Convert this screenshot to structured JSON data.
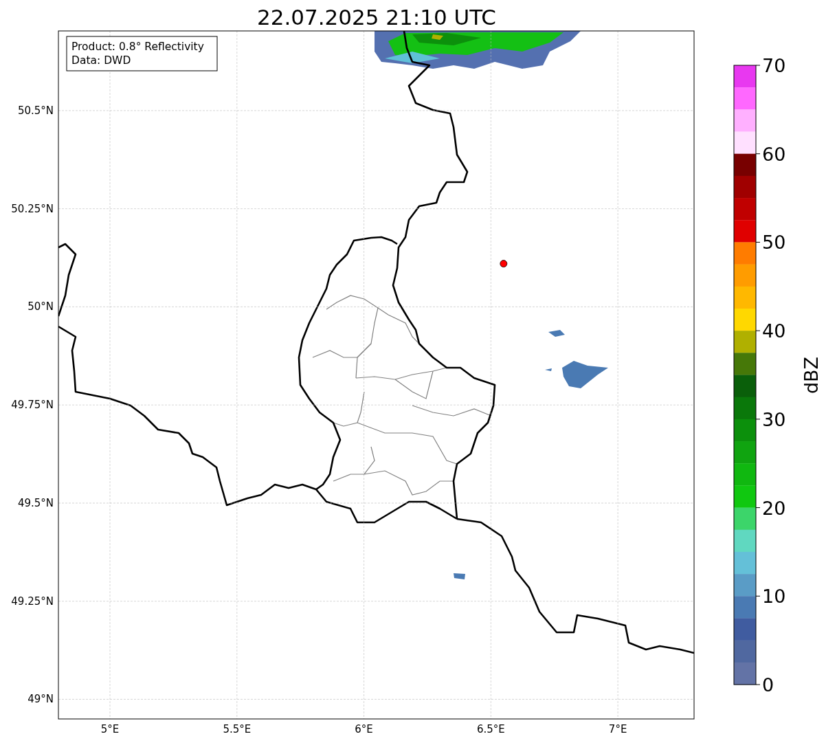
{
  "title": "22.07.2025 21:10 UTC",
  "info": [
    "Product: 0.8° Reflectivity",
    "Data: DWD"
  ],
  "chart_data": {
    "type": "scatter",
    "grid": true,
    "xlim": [
      4.797,
      7.3
    ],
    "ylim": [
      48.95,
      50.703
    ],
    "xticks": [
      {
        "value": 5,
        "label": "5°E"
      },
      {
        "value": 5.5,
        "label": "5.5°E"
      },
      {
        "value": 6,
        "label": "6°E"
      },
      {
        "value": 6.5,
        "label": "6.5°E"
      },
      {
        "value": 7,
        "label": "7°E"
      }
    ],
    "yticks": [
      {
        "value": 49,
        "label": "49°N"
      },
      {
        "value": 49.25,
        "label": "49.25°N"
      },
      {
        "value": 49.5,
        "label": "49.5°N"
      },
      {
        "value": 49.75,
        "label": "49.75°N"
      },
      {
        "value": 50,
        "label": "50°N"
      },
      {
        "value": 50.25,
        "label": "50.25°N"
      },
      {
        "value": 50.5,
        "label": "50.5°N"
      }
    ],
    "x": [
      6.55
    ],
    "series": [
      {
        "color": "#ff0000",
        "values": [
          50.11
        ]
      }
    ]
  },
  "colorbar": {
    "label": "dBZ",
    "ticks": [
      "70",
      "60",
      "50",
      "40",
      "30",
      "20",
      "10",
      "0"
    ],
    "bins": [
      {
        "color": "#e838f0"
      },
      {
        "color": "#ff68ff"
      },
      {
        "color": "#ffb0ff"
      },
      {
        "color": "#ffe0ff"
      },
      {
        "color": "#780000"
      },
      {
        "color": "#a00000"
      },
      {
        "color": "#c00000"
      },
      {
        "color": "#e00000"
      },
      {
        "color": "#ff7c00"
      },
      {
        "color": "#ff9c00"
      },
      {
        "color": "#ffb800"
      },
      {
        "color": "#ffd800"
      },
      {
        "color": "#b0b000"
      },
      {
        "color": "#467808"
      },
      {
        "color": "#0a5f0a"
      },
      {
        "color": "#0a780a"
      },
      {
        "color": "#0c900c"
      },
      {
        "color": "#10a410"
      },
      {
        "color": "#10b810"
      },
      {
        "color": "#10c810"
      },
      {
        "color": "#3cd56a"
      },
      {
        "color": "#60d8c0"
      },
      {
        "color": "#64c0d8"
      },
      {
        "color": "#5a9cc6"
      },
      {
        "color": "#4a7ab3"
      },
      {
        "color": "#405ca0"
      },
      {
        "color": "#5068a0"
      },
      {
        "color": "#6373a6"
      }
    ]
  }
}
